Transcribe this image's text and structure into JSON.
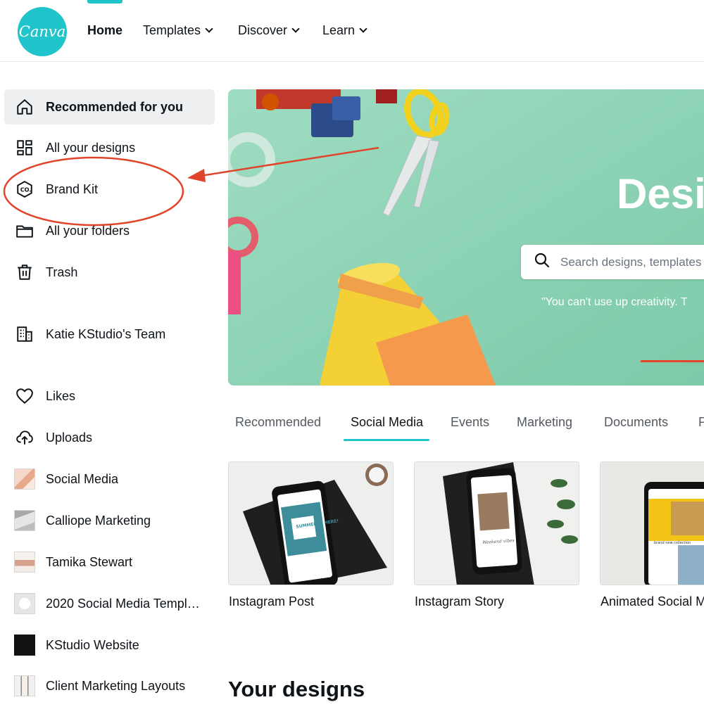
{
  "header": {
    "logo_text": "Canva",
    "nav": [
      {
        "label": "Home",
        "active": true,
        "dropdown": false
      },
      {
        "label": "Templates",
        "active": false,
        "dropdown": true
      },
      {
        "label": "Discover",
        "active": false,
        "dropdown": true
      },
      {
        "label": "Learn",
        "active": false,
        "dropdown": true
      }
    ]
  },
  "sidebar": {
    "items": [
      {
        "label": "Recommended for you",
        "icon": "home-icon",
        "active": true
      },
      {
        "label": "All your designs",
        "icon": "grid-icon"
      },
      {
        "label": "Brand Kit",
        "icon": "brand-kit-icon"
      },
      {
        "label": "All your folders",
        "icon": "folder-icon"
      },
      {
        "label": "Trash",
        "icon": "trash-icon"
      },
      {
        "label": "Katie KStudio's Team",
        "icon": "team-building-icon"
      },
      {
        "label": "Likes",
        "icon": "heart-icon"
      },
      {
        "label": "Uploads",
        "icon": "cloud-upload-icon"
      },
      {
        "label": "Social Media",
        "icon": "folder-thumbnail"
      },
      {
        "label": "Calliope Marketing",
        "icon": "folder-thumbnail"
      },
      {
        "label": "Tamika Stewart",
        "icon": "folder-thumbnail"
      },
      {
        "label": "2020 Social Media Templa...",
        "icon": "folder-thumbnail"
      },
      {
        "label": "KStudio Website",
        "icon": "folder-thumbnail"
      },
      {
        "label": "Client Marketing Layouts",
        "icon": "folder-thumbnail"
      }
    ]
  },
  "hero": {
    "title": "Desig",
    "search_placeholder": "Search designs, templates",
    "quote": "\"You can't use up creativity. T"
  },
  "tabs": [
    {
      "label": "Recommended",
      "active": false
    },
    {
      "label": "Social Media",
      "active": true
    },
    {
      "label": "Events",
      "active": false
    },
    {
      "label": "Marketing",
      "active": false
    },
    {
      "label": "Documents",
      "active": false
    },
    {
      "label": "P",
      "active": false
    }
  ],
  "cards": [
    {
      "label": "Instagram Post",
      "screen_text": "SUMMER IS HERE!"
    },
    {
      "label": "Instagram Story",
      "screen_text": "Weekend vibes"
    },
    {
      "label": "Animated Social M",
      "screen_text": "brand new collection"
    }
  ],
  "your_designs_title": "Your designs",
  "colors": {
    "brand_teal": "#20c4cb",
    "annotation_red": "#e0452b",
    "hero_mint": "#8fd3b7"
  }
}
